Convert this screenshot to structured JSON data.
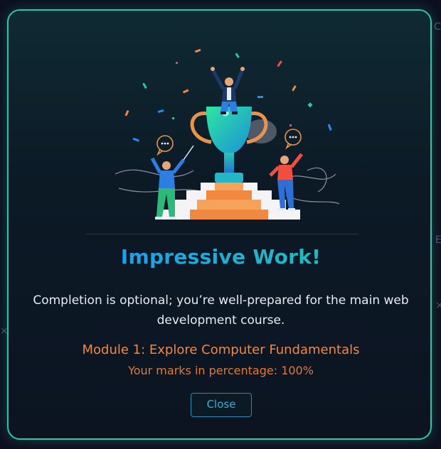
{
  "modal": {
    "title": "Impressive Work!",
    "message": "Completion is optional; you’re well-prepared for the main web development course.",
    "module_title": "Module 1: Explore Computer Fundamentals",
    "marks_text": "Your marks in percentage: 100%",
    "close_label": "Close",
    "illustration": "trophy-celebration-illustration"
  },
  "colors": {
    "border": "#27c9a6",
    "title_gradient_start": "#1f8fff",
    "title_gradient_end": "#27c9a6",
    "module_text": "#f0893f",
    "close_button": "#27b6d8"
  }
}
